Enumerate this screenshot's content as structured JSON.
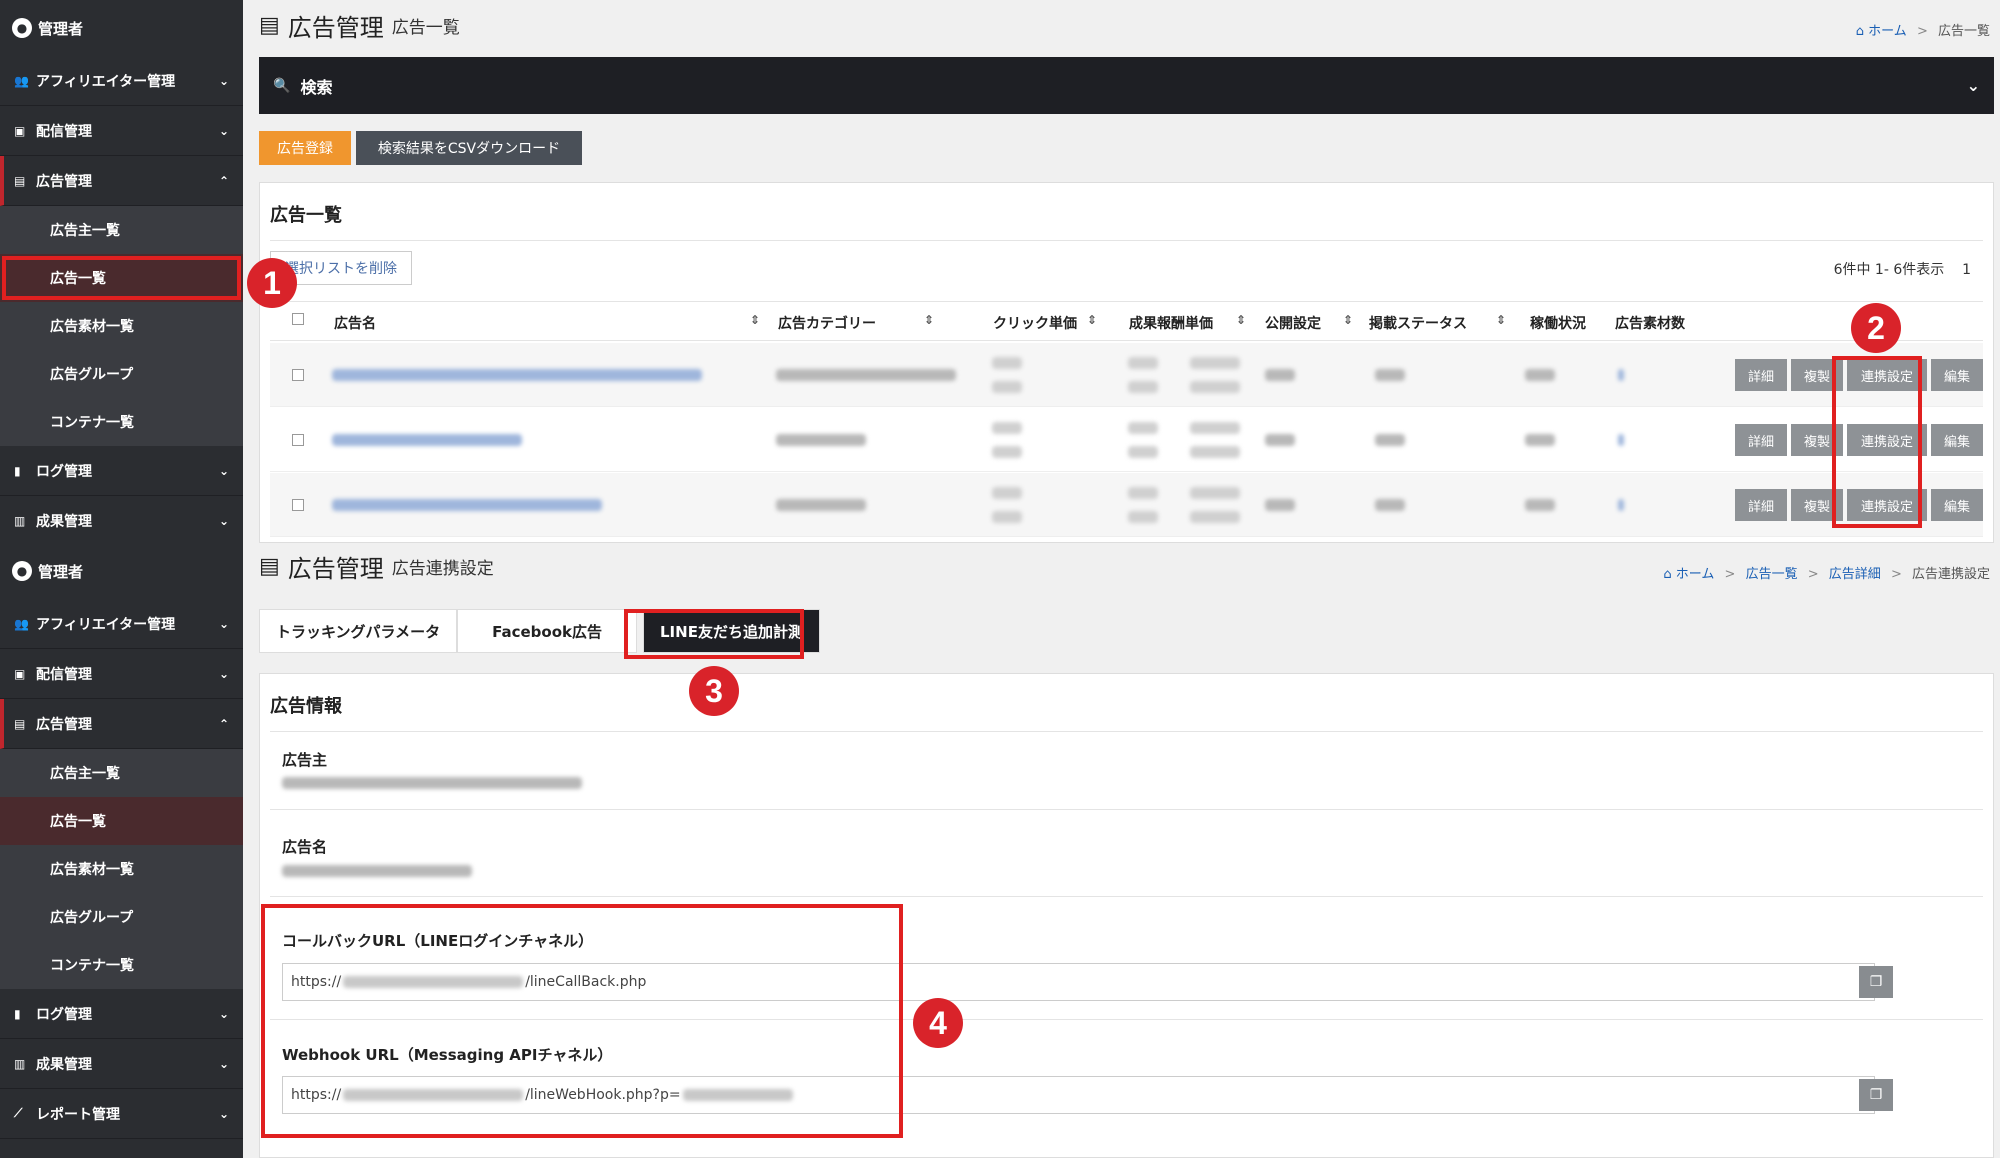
{
  "sidebar": {
    "user": "管理者",
    "items": {
      "affiliator": "アフィリエイター管理",
      "delivery": "配信管理",
      "ads": "広告管理",
      "logs": "ログ管理",
      "results": "成果管理",
      "reports": "レポート管理"
    },
    "ads_sub": [
      "広告主一覧",
      "広告一覧",
      "広告素材一覧",
      "広告グループ",
      "コンテナ一覧"
    ]
  },
  "screen1": {
    "title": "広告管理",
    "subtitle": "広告一覧",
    "breadcrumb": {
      "home": "ホーム",
      "current": "広告一覧"
    },
    "search_label": "検索",
    "register_button": "広告登録",
    "csv_button": "検索結果をCSVダウンロード",
    "panel_title": "広告一覧",
    "delete_selected": "選択リストを削除",
    "count_text": "6件中 1- 6件表示",
    "page": "1",
    "columns": [
      "広告名",
      "広告カテゴリー",
      "クリック単価",
      "成果報酬単価",
      "公開設定",
      "掲載ステータス",
      "稼働状況",
      "広告素材数"
    ],
    "row_actions": [
      "詳細",
      "複製",
      "連携設定",
      "編集"
    ]
  },
  "screen2": {
    "title": "広告管理",
    "subtitle": "広告連携設定",
    "breadcrumb": {
      "home": "ホーム",
      "list": "広告一覧",
      "detail": "広告詳細",
      "current": "広告連携設定"
    },
    "tabs": [
      "トラッキングパラメータ",
      "Facebook広告",
      "LINE友だち追加計測"
    ],
    "panel_title": "広告情報",
    "advertiser_label": "広告主",
    "ad_name_label": "広告名",
    "callback_label": "コールバックURL（LINEログインチャネル）",
    "callback_prefix": "https://",
    "callback_suffix": "/lineCallBack.php",
    "webhook_label": "Webhook URL（Messaging APIチャネル）",
    "webhook_prefix": "https://",
    "webhook_suffix": "/lineWebHook.php?p="
  },
  "annotations": [
    "1",
    "2",
    "3",
    "4"
  ],
  "colors": {
    "sidebar": "#2b2d31",
    "accent_red": "#d9232a",
    "orange": "#f0962e",
    "link": "#1a5fb4"
  }
}
